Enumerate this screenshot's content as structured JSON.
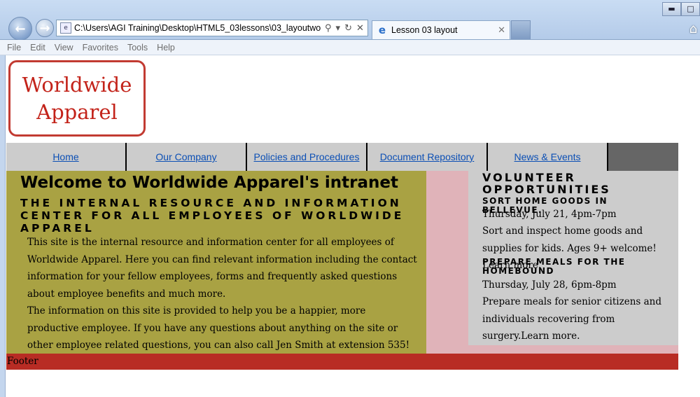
{
  "browser": {
    "address": "C:\\Users\\AGI Training\\Desktop\\HTML5_03lessons\\03_layoutwork.h",
    "tab_title": "Lesson 03 layout",
    "menu": [
      "File",
      "Edit",
      "View",
      "Favorites",
      "Tools",
      "Help"
    ]
  },
  "logo": {
    "line1": "Worldwide",
    "line2": "Apparel"
  },
  "nav": {
    "items": [
      "Home",
      "Our Company",
      "Policies and Procedures",
      "Document Repository",
      "News & Events"
    ]
  },
  "main": {
    "title": "Welcome to Worldwide Apparel's intranet",
    "subtitle": "The internal resource and information center for all employees of Worldwide Apparel",
    "paragraphs": [
      "This site is the internal resource and information center for all employees of Worldwide Apparel. Here you can find relevant information including the contact information for your fellow employees, forms and frequently asked questions about employee benefits and much more.",
      "The information on this site is provided to help you be a happier, more productive employee. If you have any questions about anything on the site or other employee related questions, you can also call Jen Smith at extension 535!"
    ]
  },
  "sidebar": {
    "heading": "Volunteer Opportunities",
    "events": [
      {
        "title": "Sort home goods in Bellevue.",
        "date": "Thursday, July 21, 4pm-7pm",
        "description": "Sort and inspect home goods and supplies for kids. Ages 9+ welcome! Learn more."
      },
      {
        "title": "Prepare meals for the homebound",
        "date": "Thursday, July 28, 6pm-8pm",
        "description": "Prepare meals for senior citizens and individuals recovering from surgery.Learn more."
      }
    ]
  },
  "footer": {
    "text": "Footer"
  },
  "colors": {
    "logo_red": "#c3231a",
    "nav_gray": "#cccccc",
    "main_olive": "#a9a243",
    "content_pink": "#e0b3b9",
    "sidebar_gray": "#cccccc",
    "footer_red": "#b82c24",
    "link_blue": "#0b4fb5"
  }
}
